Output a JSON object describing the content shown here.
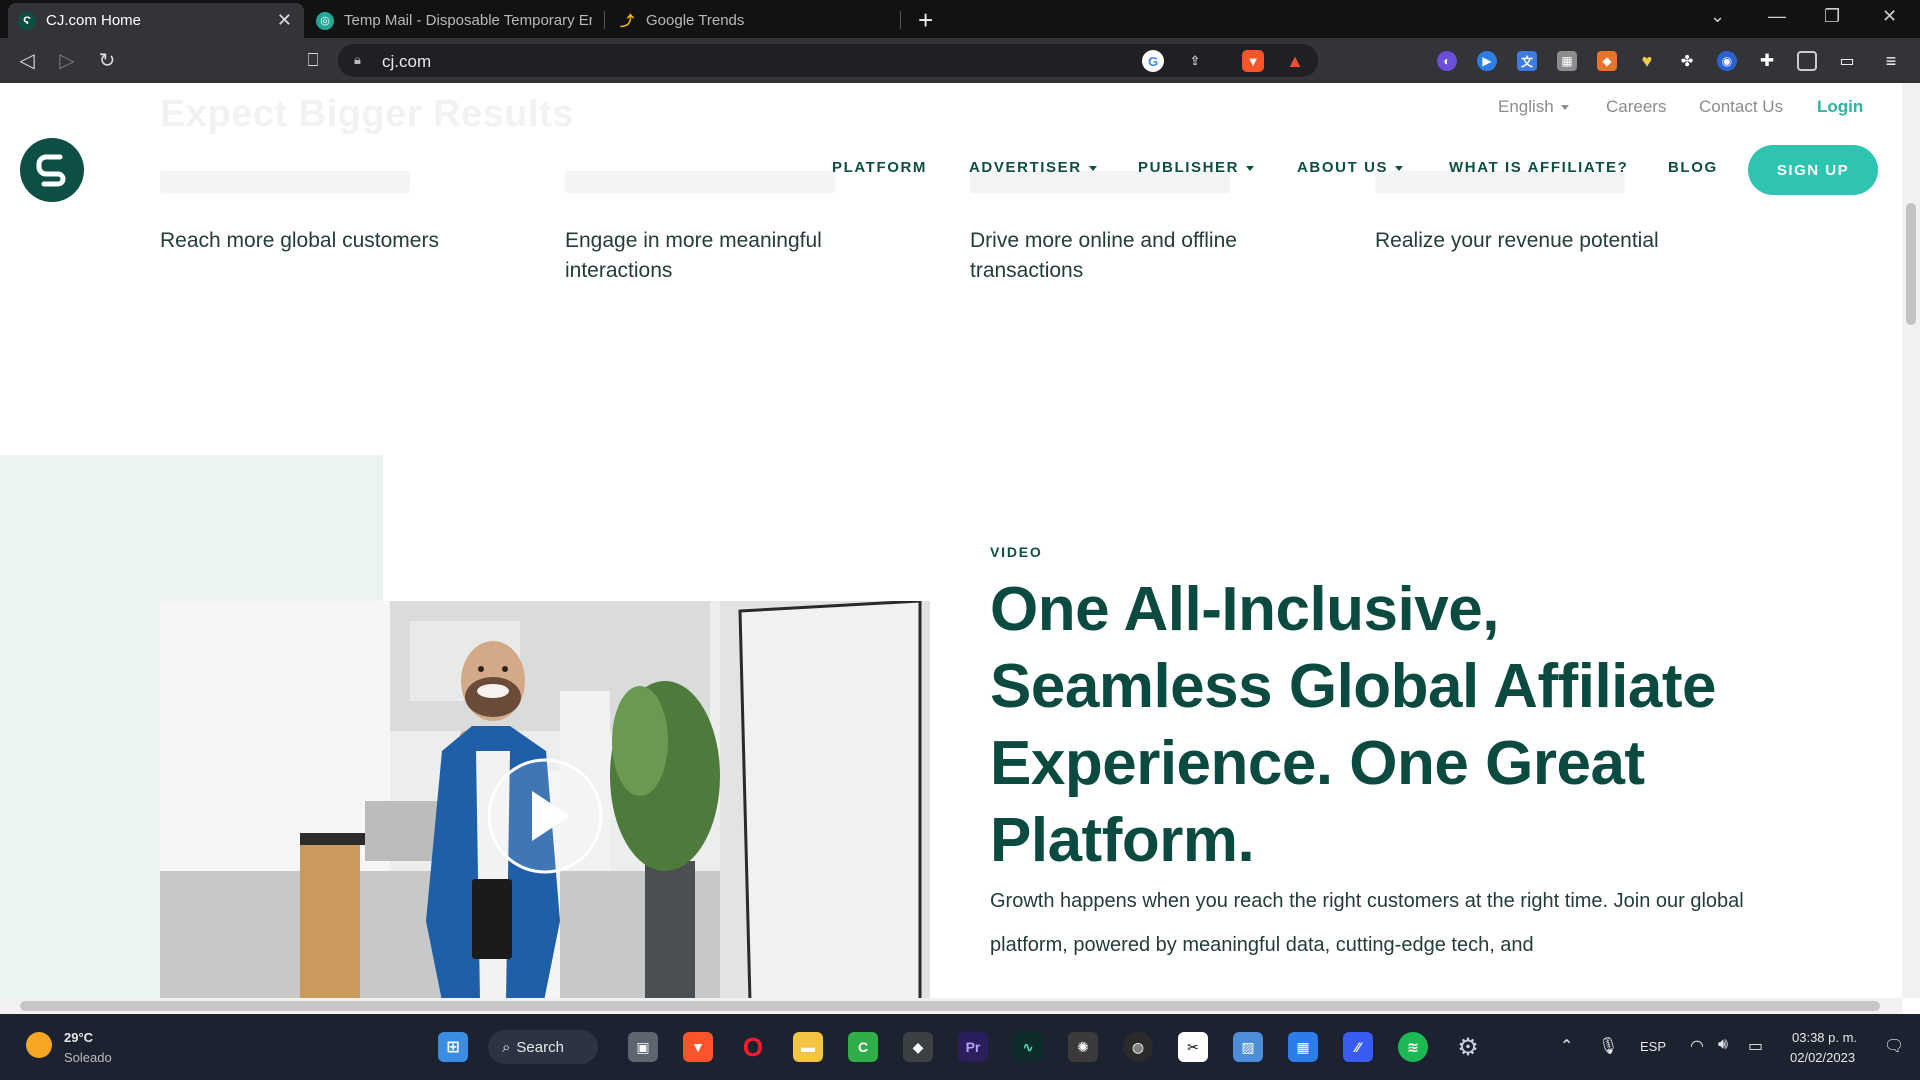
{
  "browser": {
    "tabs": [
      {
        "title": "CJ.com Home",
        "active": true
      },
      {
        "title": "Temp Mail - Disposable Temporary Em",
        "active": false
      },
      {
        "title": "Google Trends",
        "active": false
      }
    ],
    "new_tab": "+",
    "url": "cj.com"
  },
  "site": {
    "utility_nav": {
      "language": "English",
      "careers": "Careers",
      "contact": "Contact Us",
      "login": "Login"
    },
    "faded_heading": "Expect Bigger Results",
    "main_nav": [
      "PLATFORM",
      "ADVERTISER",
      "PUBLISHER",
      "ABOUT US",
      "WHAT IS AFFILIATE?",
      "BLOG"
    ],
    "signup": "SIGN UP",
    "benefits": [
      "Reach more global customers",
      "Engage in more meaningful interactions",
      "Drive more online and offline transactions",
      "Realize your revenue potential"
    ],
    "video_section": {
      "eyebrow": "VIDEO",
      "headline": "One All-Inclusive, Seamless Global Affiliate Experience. One Great Platform.",
      "body": "Growth happens when you reach the right customers at the right time. Join our global platform, powered by meaningful data, cutting-edge tech, and"
    }
  },
  "taskbar": {
    "weather_temp": "29°C",
    "weather_desc": "Soleado",
    "search": "Search",
    "language": "ESP",
    "time": "03:38 p. m.",
    "date": "02/02/2023"
  },
  "colors": {
    "brand_dark": "#0d4f44",
    "brand_teal": "#2ec4b0",
    "mint_bg": "#eaf4f2"
  }
}
